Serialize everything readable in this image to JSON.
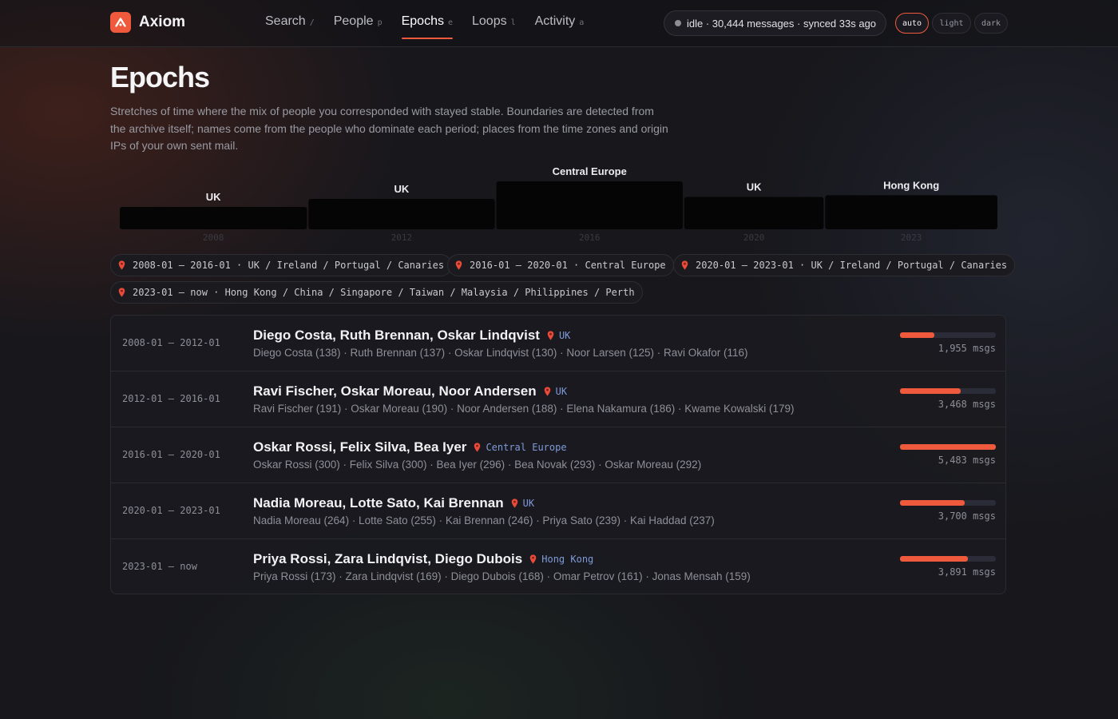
{
  "app": {
    "name": "Axiom"
  },
  "nav": [
    {
      "label": "Search",
      "key": "/"
    },
    {
      "label": "People",
      "key": "p"
    },
    {
      "label": "Epochs",
      "key": "e",
      "active": true
    },
    {
      "label": "Loops",
      "key": "l"
    },
    {
      "label": "Activity",
      "key": "a"
    }
  ],
  "status": {
    "text": "idle · 30,444 messages · synced 33s ago"
  },
  "theme": {
    "options": [
      "auto",
      "light",
      "dark"
    ],
    "selected": "auto"
  },
  "page": {
    "title": "Epochs",
    "description": "Stretches of time where the mix of people you corresponded with stayed stable. Boundaries are detected from the archive itself; names come from the people who dominate each period; places from the time zones and origin IPs of your own sent mail."
  },
  "timeline": [
    {
      "place": "UK",
      "year": "2008",
      "start": 2008,
      "end": 2012,
      "messages": 1955
    },
    {
      "place": "UK",
      "year": "2012",
      "start": 2012,
      "end": 2016,
      "messages": 3468
    },
    {
      "place": "Central Europe",
      "year": "2016",
      "start": 2016,
      "end": 2020,
      "messages": 5483
    },
    {
      "place": "UK",
      "year": "2020",
      "start": 2020,
      "end": 2023,
      "messages": 3700
    },
    {
      "place": "Hong Kong",
      "year": "2023",
      "start": 2023,
      "end": 2026.7,
      "messages": 3891
    }
  ],
  "place_chips": [
    "2008-01 — 2016-01 · UK / Ireland / Portugal / Canaries",
    "2016-01 — 2020-01 · Central Europe",
    "2020-01 — 2023-01 · UK / Ireland / Portugal / Canaries",
    "2023-01 — now · Hong Kong / China / Singapore / Taiwan / Malaysia / Philippines / Perth"
  ],
  "epochs": [
    {
      "range": "2008-01 — 2012-01",
      "names": "Diego Costa, Ruth Brennan, Oskar Lindqvist",
      "place": "UK",
      "people": "Diego Costa (138) · Ruth Brennan (137) · Oskar Lindqvist (130) · Noor Larsen (125) · Ravi Okafor (116)",
      "share": 0.357,
      "count": "1,955 msgs"
    },
    {
      "range": "2012-01 — 2016-01",
      "names": "Ravi Fischer, Oskar Moreau, Noor Andersen",
      "place": "UK",
      "people": "Ravi Fischer (191) · Oskar Moreau (190) · Noor Andersen (188) · Elena Nakamura (186) · Kwame Kowalski (179)",
      "share": 0.633,
      "count": "3,468 msgs"
    },
    {
      "range": "2016-01 — 2020-01",
      "names": "Oskar Rossi, Felix Silva, Bea Iyer",
      "place": "Central Europe",
      "people": "Oskar Rossi (300) · Felix Silva (300) · Bea Iyer (296) · Bea Novak (293) · Oskar Moreau (292)",
      "share": 1.0,
      "count": "5,483 msgs"
    },
    {
      "range": "2020-01 — 2023-01",
      "names": "Nadia Moreau, Lotte Sato, Kai Brennan",
      "place": "UK",
      "people": "Nadia Moreau (264) · Lotte Sato (255) · Kai Brennan (246) · Priya Sato (239) · Kai Haddad (237)",
      "share": 0.675,
      "count": "3,700 msgs"
    },
    {
      "range": "2023-01 — now",
      "names": "Priya Rossi, Zara Lindqvist, Diego Dubois",
      "place": "Hong Kong",
      "people": "Priya Rossi (173) · Zara Lindqvist (169) · Diego Dubois (168) · Omar Petrov (161) · Jonas Mensah (159)",
      "share": 0.71,
      "count": "3,891 msgs"
    }
  ],
  "colors": {
    "accent": "#ef5a3c",
    "place": "#7f9bd8",
    "bar_track": "#2a2d38"
  }
}
